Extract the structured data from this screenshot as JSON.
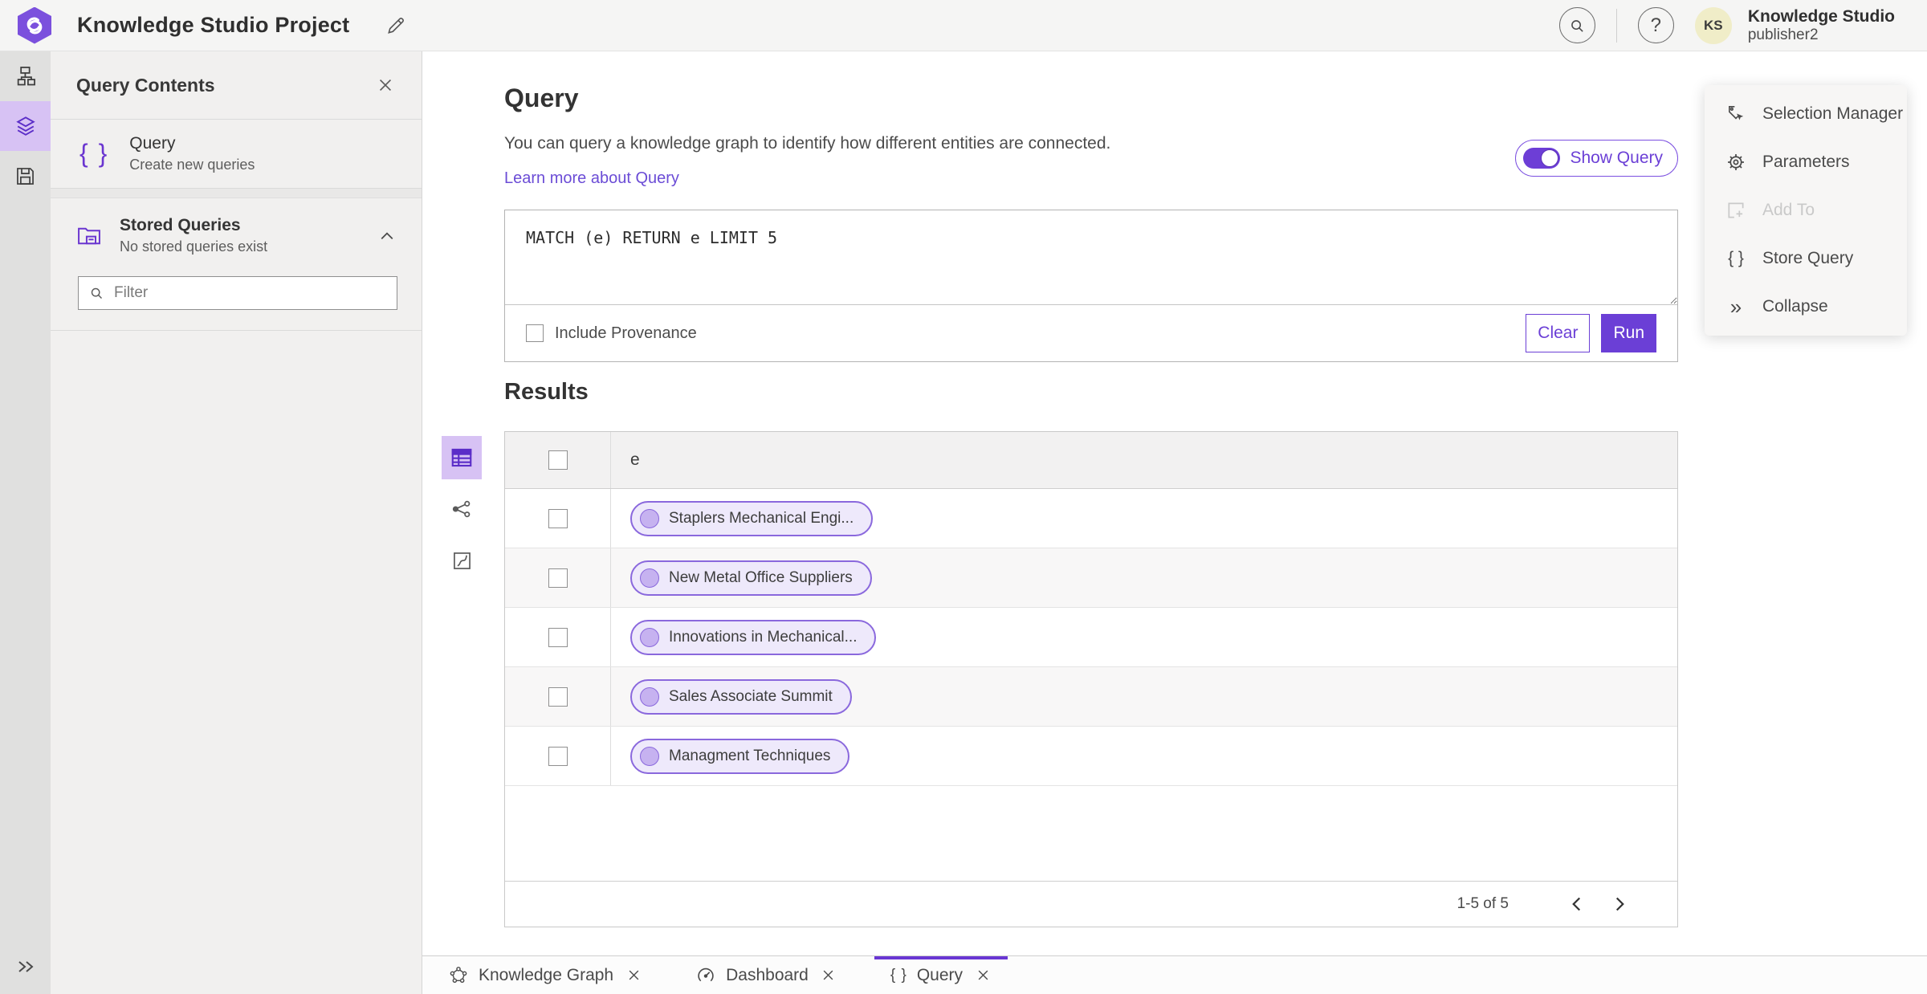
{
  "header": {
    "app_title": "Knowledge Studio Project",
    "help_glyph": "?",
    "user": {
      "initials": "KS",
      "name": "Knowledge Studio",
      "role": "publisher2"
    }
  },
  "left_panel": {
    "title": "Query Contents",
    "query_item": {
      "icon_glyph": "{ }",
      "title": "Query",
      "subtitle": "Create new queries"
    },
    "stored_queries": {
      "title": "Stored Queries",
      "subtitle": "No stored queries exist"
    },
    "filter": {
      "placeholder": "Filter"
    }
  },
  "query_panel": {
    "title": "Query",
    "description": "You can query a knowledge graph to identify how different entities are connected.",
    "learn_more": "Learn more about Query",
    "show_query_toggle": "Show Query",
    "query_text": "MATCH (e) RETURN e LIMIT 5",
    "include_provenance": "Include Provenance",
    "clear_button": "Clear",
    "run_button": "Run"
  },
  "results": {
    "title": "Results",
    "column_header": "e",
    "rows": [
      {
        "label": "Staplers Mechanical Engi..."
      },
      {
        "label": "New Metal Office Suppliers"
      },
      {
        "label": "Innovations in Mechanical..."
      },
      {
        "label": "Sales Associate Summit"
      },
      {
        "label": "Managment Techniques"
      }
    ],
    "pagination": {
      "range_label": "1-5 of 5"
    }
  },
  "right_menu": {
    "items": [
      {
        "label": "Selection Manager",
        "disabled": false
      },
      {
        "label": "Parameters",
        "disabled": false
      },
      {
        "label": "Add To",
        "disabled": true
      },
      {
        "label": "Store Query",
        "disabled": false,
        "icon_glyph": "{ }"
      },
      {
        "label": "Collapse",
        "disabled": false,
        "icon_glyph": "»"
      }
    ]
  },
  "tabs": [
    {
      "label": "Knowledge Graph",
      "active": false
    },
    {
      "label": "Dashboard",
      "active": false
    },
    {
      "label": "Query",
      "active": true,
      "icon_glyph": "{ }"
    }
  ],
  "colors": {
    "accent_purple": "#6b3fd6",
    "accent_purple_dark": "#5b2dc8",
    "selected_light_purple": "#d7c2f4",
    "pill_fill": "#eee9fb",
    "pill_dot": "#c6b2f0",
    "avatar_bg": "#f0edc8",
    "link_purple": "#6b4cd6"
  }
}
